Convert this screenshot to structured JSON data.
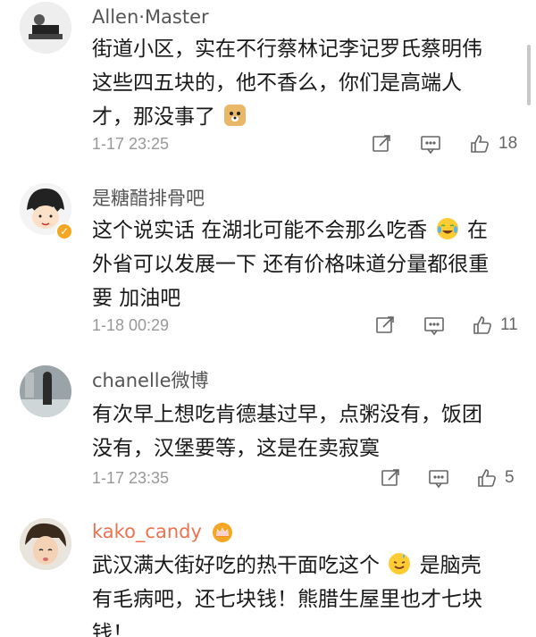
{
  "comments": [
    {
      "username": "Allen·Master",
      "lines": [
        "街道小区，实在不行蔡林记李记罗氏蔡明伟",
        "这些四五块的，他不香么，你们是高端人",
        "才，那没事了"
      ],
      "emoji_after_last": "doge-emoji",
      "time": "1-17 23:25",
      "likes": "18"
    },
    {
      "username": "是糖醋排骨吧",
      "lines": [
        "这个说实话 在湖北可能不会那么吃香",
        "外省可以发展一下 还有价格味道分量都很重",
        "要 加油吧"
      ],
      "line1_suffix": "在",
      "emoji_mid_line1": "laugh-cry-emoji",
      "time": "1-18 00:29",
      "likes": "11"
    },
    {
      "username": "chanelle微博",
      "lines": [
        "有次早上想吃肯德基过早，点粥没有，饭团",
        "没有，汉堡要等，这是在卖寂寞"
      ],
      "time": "1-17 23:35",
      "likes": "5"
    },
    {
      "username": "kako_candy",
      "lines": [
        "武汉满大街好吃的热干面吃这个",
        "有毛病吧，还七块钱！熊腊生屋里也才七块",
        "钱！"
      ],
      "line1_suffix": "是脑壳",
      "emoji_mid_line1": "sweat-smile-emoji"
    }
  ],
  "colors": {
    "vip_username": "#eb7350",
    "username": "#555555",
    "meta": "#999999"
  }
}
